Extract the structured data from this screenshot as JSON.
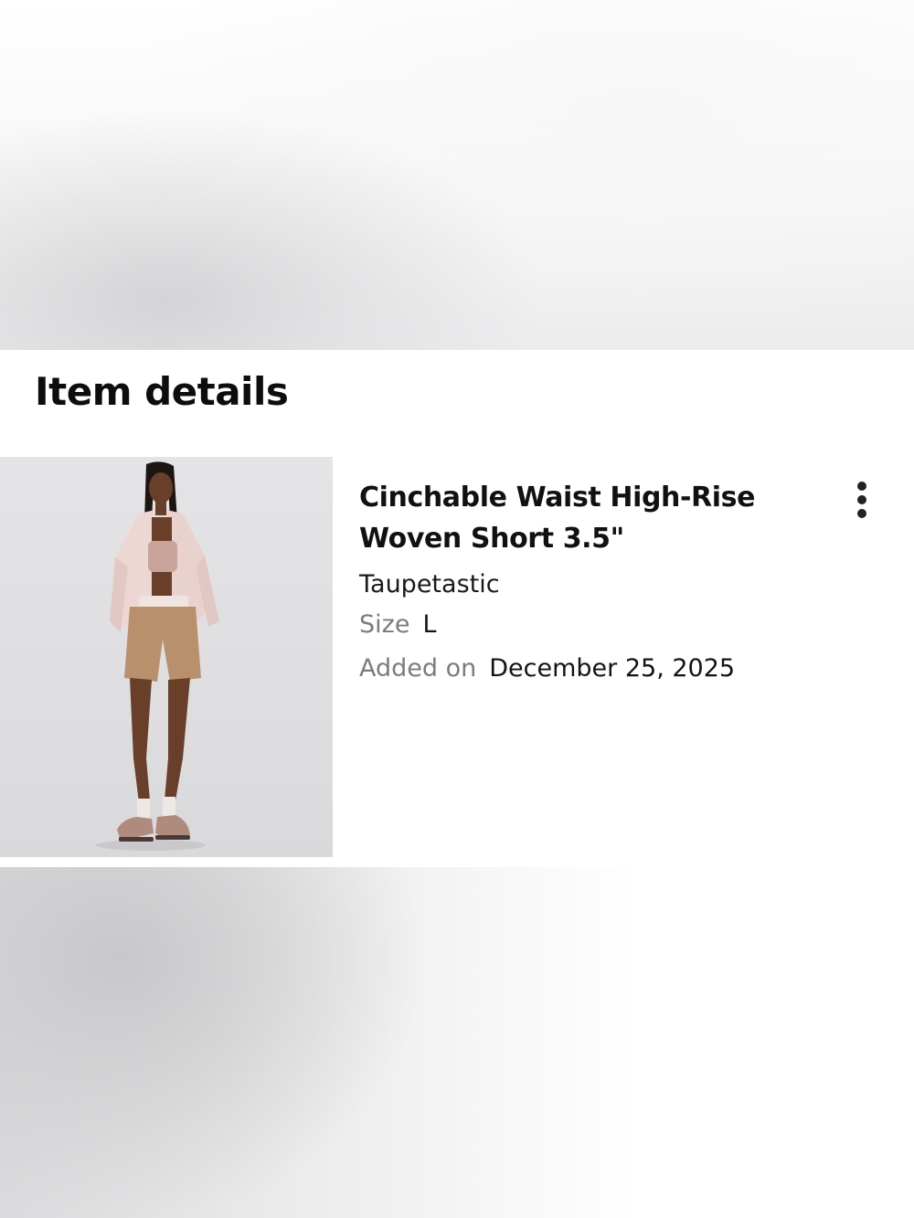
{
  "header": {
    "title": "Item details"
  },
  "item": {
    "name": "Cinchable Waist High-Rise\nWoven Short 3.5\"",
    "color": "Taupetastic",
    "size_label": "Size",
    "size_value": "L",
    "added_label": "Added on",
    "added_value": "December 25, 2025",
    "more_icon": "more-vertical-icon",
    "image": "product-photo"
  },
  "colors": {
    "text_primary": "#111111",
    "text_secondary": "#7c7c80",
    "background": "#ffffff",
    "image_background": "#e0e0e2"
  }
}
